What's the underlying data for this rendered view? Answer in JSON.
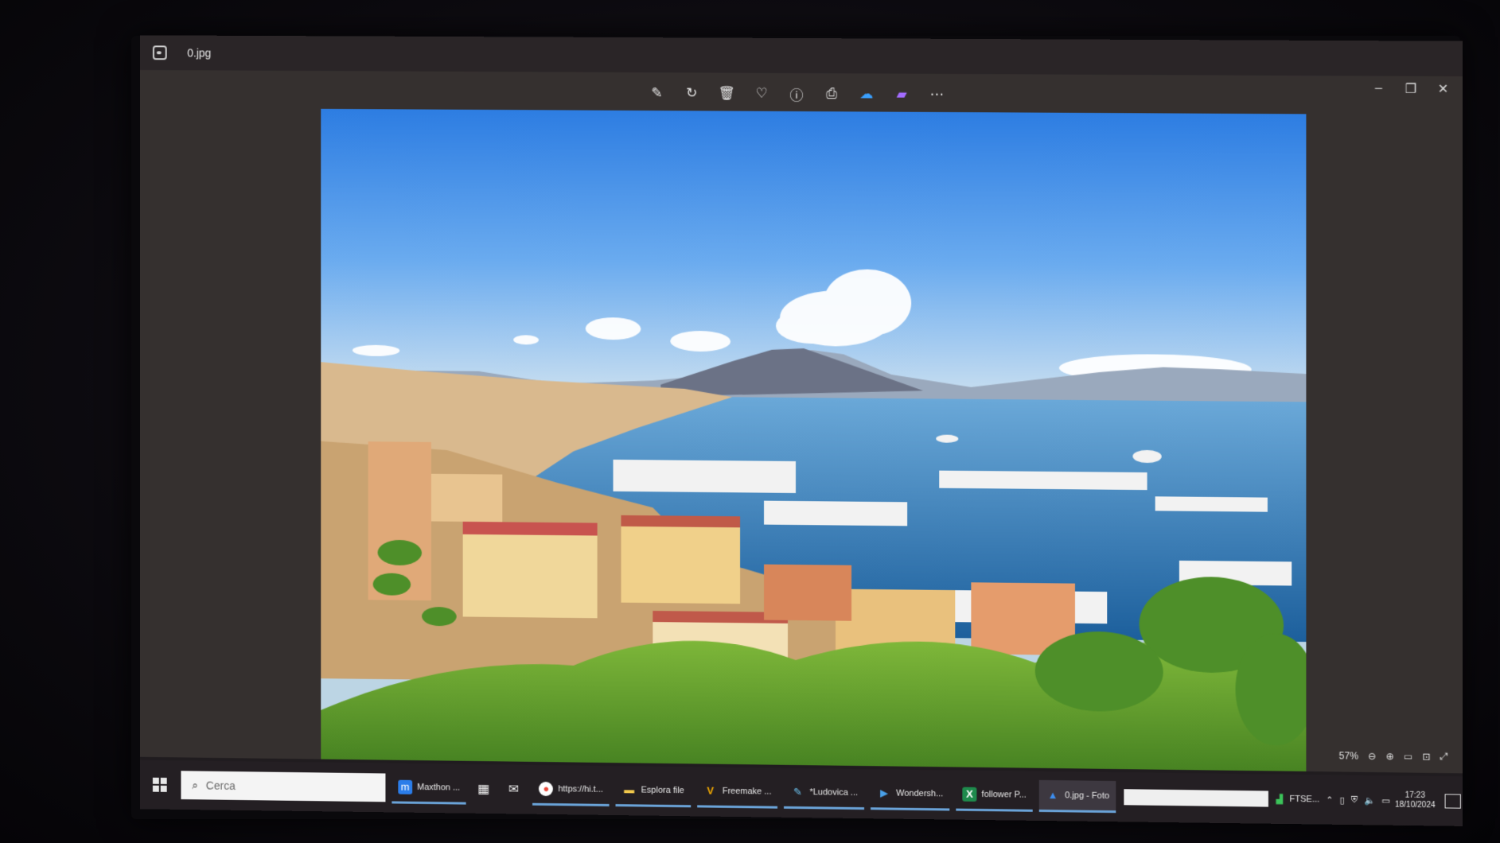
{
  "window": {
    "file_name": "0.jpg",
    "toolbar": [
      {
        "name": "edit-icon",
        "glyph": "✎"
      },
      {
        "name": "rotate-icon",
        "glyph": "↻"
      },
      {
        "name": "delete-icon",
        "glyph": "🗑"
      },
      {
        "name": "favorite-icon",
        "glyph": "♡"
      },
      {
        "name": "info-icon",
        "glyph": "ⓘ"
      },
      {
        "name": "print-icon",
        "glyph": "⎙"
      },
      {
        "name": "onedrive-icon",
        "glyph": "☁"
      },
      {
        "name": "clipchamp-icon",
        "glyph": "▰"
      },
      {
        "name": "more-icon",
        "glyph": "⋯"
      }
    ],
    "controls": {
      "minimize": "–",
      "maximize": "❐",
      "close": "✕"
    },
    "zoom_level": "57%"
  },
  "taskbar": {
    "search_placeholder": "Cerca",
    "items": [
      {
        "name": "maxthon",
        "label": "Maxthon ...",
        "icon": "m",
        "color": "#2b7de9"
      },
      {
        "name": "https",
        "label": "https://hi.t...",
        "icon": "●",
        "color": "#e9483a"
      },
      {
        "name": "esplora-file",
        "label": "Esplora file",
        "icon": "▬",
        "color": "#f2c94c"
      },
      {
        "name": "freemake",
        "label": "Freemake ...",
        "icon": "V",
        "color": "#f2a900"
      },
      {
        "name": "ludovica",
        "label": "*Ludovica ...",
        "icon": "✎",
        "color": "#6cc3f0"
      },
      {
        "name": "wondershare",
        "label": "Wondersh...",
        "icon": "▶",
        "color": "#49a0e8"
      },
      {
        "name": "follower",
        "label": "follower P...",
        "icon": "X",
        "color": "#1e8a4c"
      },
      {
        "name": "foto",
        "label": "0.jpg - Foto",
        "icon": "▲",
        "color": "#3d8ef0"
      }
    ],
    "tray_ticker": "FTSE...",
    "clock_time": "17:23",
    "clock_date": "18/10/2024"
  }
}
